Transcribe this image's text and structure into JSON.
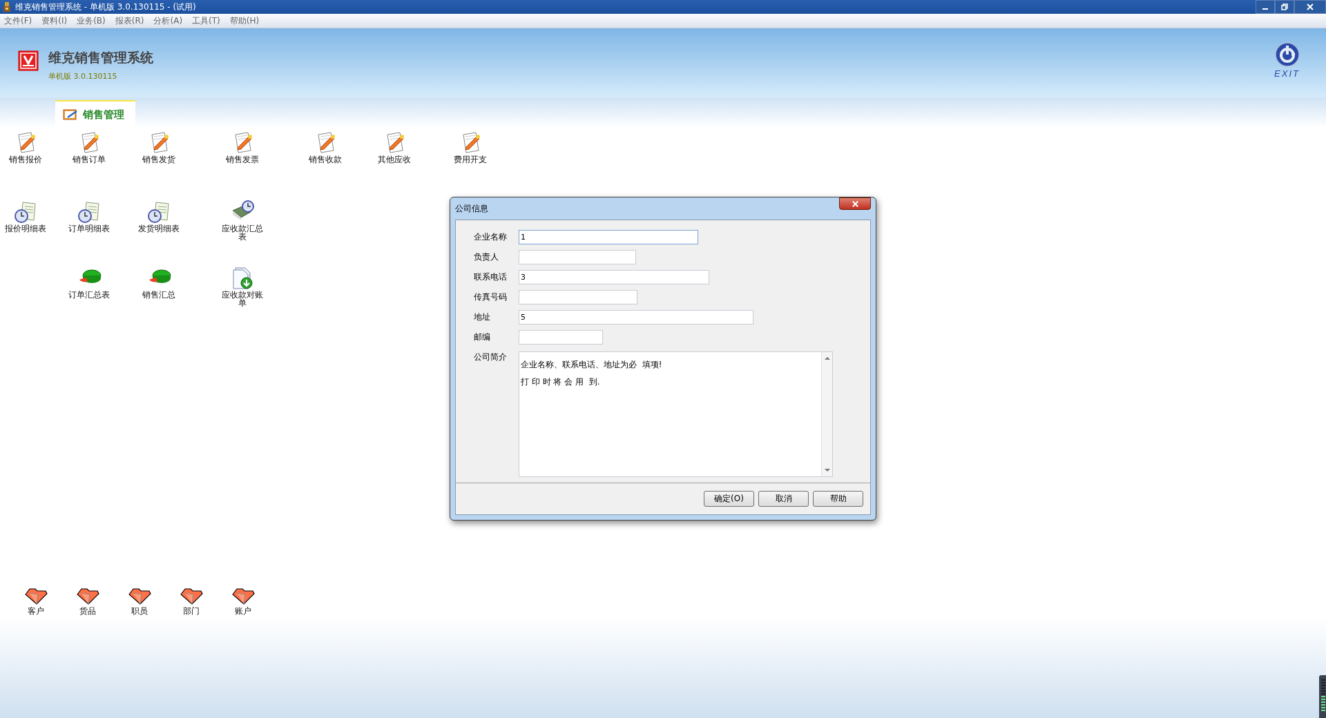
{
  "window": {
    "title": "维克销售管理系统 - 单机版 3.0.130115 - (试用)"
  },
  "menu": [
    "文件(F)",
    "资料(I)",
    "业务(B)",
    "报表(R)",
    "分析(A)",
    "工具(T)",
    "帮助(H)"
  ],
  "header": {
    "app_name": "维克销售管理系统",
    "version": "单机版 3.0.130115",
    "exit_label": "EXIT"
  },
  "tabs": [
    {
      "label": "销售管理",
      "selected": true
    }
  ],
  "function_rows": [
    [
      {
        "label": "销售报价",
        "kind": "edit"
      },
      {
        "label": "销售订单",
        "kind": "edit"
      },
      {
        "label": "销售发货",
        "kind": "edit"
      },
      {
        "label": "销售发票",
        "kind": "edit"
      },
      {
        "label": "销售收款",
        "kind": "edit"
      },
      {
        "label": "其他应收",
        "kind": "edit"
      },
      {
        "label": "费用开支",
        "kind": "edit"
      }
    ],
    [
      {
        "label": "报价明细表",
        "kind": "report"
      },
      {
        "label": "订单明细表",
        "kind": "report"
      },
      {
        "label": "发货明细表",
        "kind": "report"
      },
      {
        "label": "应收款汇总表",
        "kind": "book"
      }
    ],
    [
      {
        "label": "订单汇总表",
        "kind": "chart"
      },
      {
        "label": "销售汇总",
        "kind": "chart"
      },
      {
        "label": "应收款对账单",
        "kind": "statement"
      }
    ]
  ],
  "basic_data": [
    "客户",
    "货品",
    "职员",
    "部门",
    "账户"
  ],
  "dialog": {
    "title": "公司信息",
    "fields": [
      {
        "label": "企业名称",
        "value": "1",
        "kind": "text",
        "focused": true
      },
      {
        "label": "负责人",
        "kind": "text",
        "focused": false
      },
      {
        "label": "联系电话",
        "value": "3",
        "kind": "text",
        "focused": false
      },
      {
        "label": "传真号码",
        "kind": "text",
        "focused": false
      },
      {
        "label": "地址",
        "value": "5",
        "kind": "text",
        "focused": false
      },
      {
        "label": "邮编",
        "kind": "text",
        "focused": false
      },
      {
        "label": "公司简介",
        "kind": "memo",
        "lines": [
          "企业名称、联系电话、地址为必  填项!",
          "打 印 时 将 会 用  到."
        ],
        "focused": false
      }
    ],
    "buttons": [
      "确定(O)",
      "取消",
      "帮助"
    ]
  }
}
